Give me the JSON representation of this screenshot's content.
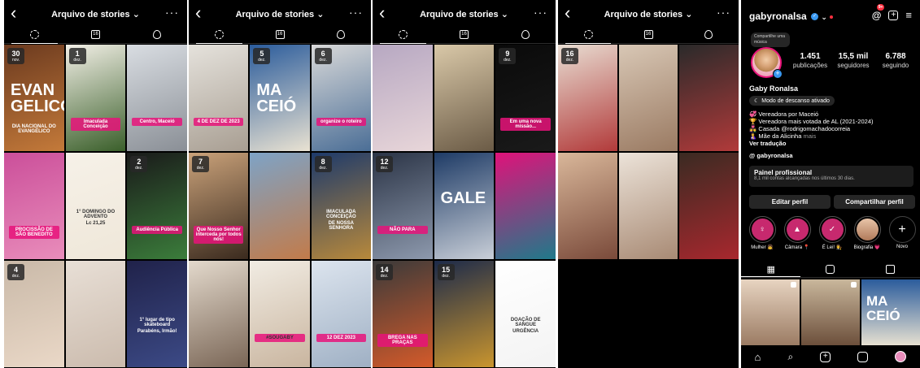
{
  "archive": {
    "back_icon": "chevron-left-icon",
    "title": "Arquivo de stories ⌄",
    "more_icon": "more-dots-icon",
    "tabs": [
      "stories-icon",
      "calendar-icon",
      "location-icon"
    ]
  },
  "panels": [
    {
      "cells": [
        {
          "day": "30",
          "month": "nov.",
          "texts": [
            "EVAN",
            "GELICO",
            "DIA NACIONAL DO EVANGÉLICO"
          ],
          "colors": [
            "#6b3a1f",
            "#c47a3a"
          ]
        },
        {
          "day": "1",
          "month": "dez.",
          "texts": [
            "Imaculada Conceição"
          ],
          "colors": [
            "#f2efe6",
            "#3a5f2a"
          ]
        },
        {
          "day": "",
          "month": "",
          "texts": [
            "Centro, Maceió"
          ],
          "colors": [
            "#d9dde2",
            "#8a8f96"
          ]
        },
        {
          "day": "",
          "month": "",
          "texts": [
            "PROCISSÃO DE SÃO BENEDITO"
          ],
          "colors": [
            "#cb4f9a",
            "#e98dbb"
          ]
        },
        {
          "day": "",
          "month": "",
          "texts": [
            "1° DOMINGO DO ADVENTO",
            "Lc 21,25"
          ],
          "colors": [
            "#f6f1e8",
            "#efe7d9"
          ]
        },
        {
          "day": "2",
          "month": "dez.",
          "texts": [
            "Audiência Pública"
          ],
          "colors": [
            "#1a1a1a",
            "#3b7d3b"
          ]
        },
        {
          "day": "4",
          "month": "dez.",
          "texts": [],
          "colors": [
            "#c9b9a8",
            "#ead8c7"
          ]
        },
        {
          "day": "",
          "month": "",
          "texts": [],
          "colors": [
            "#e8dfd6",
            "#cbbbad"
          ]
        },
        {
          "day": "",
          "month": "",
          "texts": [
            "1° lugar de tipo skateboard",
            "Parabéns, Irmão!"
          ],
          "colors": [
            "#20224a",
            "#3c4a86"
          ]
        }
      ]
    },
    {
      "cells": [
        {
          "day": "",
          "month": "",
          "texts": [
            "4 DE DEZ DE 2023"
          ],
          "colors": [
            "#e5e2dc",
            "#a89e92"
          ]
        },
        {
          "day": "5",
          "month": "dez.",
          "texts": [
            "MA",
            "CEIÓ"
          ],
          "colors": [
            "#2b5c9c",
            "#e9e2d2"
          ]
        },
        {
          "day": "6",
          "month": "dez.",
          "texts": [
            "organize o roteiro"
          ],
          "colors": [
            "#d9d9d9",
            "#4b6e96"
          ]
        },
        {
          "day": "7",
          "month": "dez.",
          "texts": [
            "Que Nosso Senhor interceda por todos nós!"
          ],
          "colors": [
            "#caa27a",
            "#3a2a1e"
          ]
        },
        {
          "day": "",
          "month": "",
          "texts": [],
          "colors": [
            "#7ea3c6",
            "#c27b4a"
          ]
        },
        {
          "day": "8",
          "month": "dez.",
          "texts": [
            "IMACULADA CONCEIÇÃO",
            "DE NOSSA SENHORA"
          ],
          "colors": [
            "#1d3a6b",
            "#b8893b"
          ]
        },
        {
          "day": "",
          "month": "",
          "texts": [],
          "colors": [
            "#e3d9cc",
            "#7a6656"
          ]
        },
        {
          "day": "",
          "month": "",
          "texts": [
            "#SOUGABY"
          ],
          "colors": [
            "#f1ece3",
            "#c9b59f"
          ]
        },
        {
          "day": "",
          "month": "",
          "texts": [
            "12 DEZ 2023"
          ],
          "colors": [
            "#dce4ee",
            "#9fb0c4"
          ]
        }
      ]
    },
    {
      "cells": [
        {
          "day": "",
          "month": "",
          "texts": [],
          "colors": [
            "#b7a8c2",
            "#e8d6d9"
          ]
        },
        {
          "day": "",
          "month": "",
          "texts": [],
          "colors": [
            "#d9c8a8",
            "#6b5b46"
          ]
        },
        {
          "day": "9",
          "month": "dez.",
          "texts": [
            "Em uma nova missão..."
          ],
          "colors": [
            "#0a0a0a",
            "#1a1a1a"
          ]
        },
        {
          "day": "12",
          "month": "dez.",
          "texts": [
            "NÃO PARA"
          ],
          "colors": [
            "#2b3446",
            "#8d99ad"
          ]
        },
        {
          "day": "",
          "month": "",
          "texts": [
            "GALE"
          ],
          "colors": [
            "#1e3b66",
            "#c9cfd8"
          ]
        },
        {
          "day": "",
          "month": "",
          "texts": [],
          "colors": [
            "#e0127a",
            "#1f7a8a"
          ]
        },
        {
          "day": "14",
          "month": "dez.",
          "texts": [
            "BREGA NAS PRAÇAS"
          ],
          "colors": [
            "#3a3a3a",
            "#d45a2a"
          ]
        },
        {
          "day": "15",
          "month": "dez.",
          "texts": [],
          "colors": [
            "#1c2a4a",
            "#c9952e"
          ]
        },
        {
          "day": "",
          "month": "",
          "texts": [
            "DOAÇÃO DE SANGUE",
            "URGÊNCIA"
          ],
          "colors": [
            "#ffffff",
            "#f3f3f3"
          ]
        }
      ]
    },
    {
      "cells": [
        {
          "day": "16",
          "month": "dez.",
          "texts": [],
          "colors": [
            "#e8ddd2",
            "#b23a3a"
          ]
        },
        {
          "day": "",
          "month": "",
          "texts": [],
          "colors": [
            "#d8c7b5",
            "#9a7a62"
          ]
        },
        {
          "day": "",
          "month": "",
          "texts": [],
          "colors": [
            "#2a2a2a",
            "#b13a3a"
          ]
        },
        {
          "day": "",
          "month": "",
          "texts": [],
          "colors": [
            "#d9b79a",
            "#7a4a3a"
          ]
        },
        {
          "day": "",
          "month": "",
          "texts": [],
          "colors": [
            "#ece3d9",
            "#a88a74"
          ]
        },
        {
          "day": "",
          "month": "",
          "texts": [],
          "colors": [
            "#3a2a22",
            "#a8282e"
          ]
        }
      ]
    }
  ],
  "profile": {
    "username": "gabyronalsa",
    "verified_icon": "verified-badge-icon",
    "threads_icon": "threads-icon",
    "threads_count": "9+",
    "add_icon": "plus-square-icon",
    "menu_icon": "hamburger-menu-icon",
    "music_tip": "Compartilhe uma música",
    "stats": [
      {
        "number": "1.451",
        "label": "publicações"
      },
      {
        "number": "15,5 mil",
        "label": "seguidores"
      },
      {
        "number": "6.788",
        "label": "seguindo"
      }
    ],
    "name": "Gaby Ronalsa",
    "rest_mode": "Modo de descanso ativado",
    "bio": [
      "💞 Vereadora por Maceió",
      "🏆 Vereadora mais votada de AL (2021-2024)",
      "👩‍❤️‍👨 Casada @rodrigomachadocorreia",
      "🤱 Mãe da Alicinha"
    ],
    "bio_more": "mais",
    "see_translation": "Ver tradução",
    "threads_handle": "gabyronalsa",
    "pro_title": "Painel profissional",
    "pro_sub": "8,1 mil contas alcançadas nos últimos 30 dias.",
    "edit_btn": "Editar perfil",
    "share_btn": "Compartilhar perfil",
    "highlights": [
      {
        "label": "Mulher 👧",
        "icon": "woman-symbol-icon"
      },
      {
        "label": "Câmara 📍",
        "icon": "building-icon"
      },
      {
        "label": "É Lei! 👨‍⚖️",
        "icon": "law-icon"
      },
      {
        "label": "Biografia 💗",
        "icon": "photo-icon"
      },
      {
        "label": "Novo",
        "icon": "plus-icon"
      }
    ],
    "bottom_nav": [
      "home-icon",
      "search-icon",
      "create-icon",
      "reels-icon",
      "profile-avatar-icon"
    ]
  },
  "theme": {
    "accent": "#e8137a",
    "bg": "#000000",
    "surface": "#262626",
    "blue": "#3897f0",
    "red": "#ff3040"
  }
}
